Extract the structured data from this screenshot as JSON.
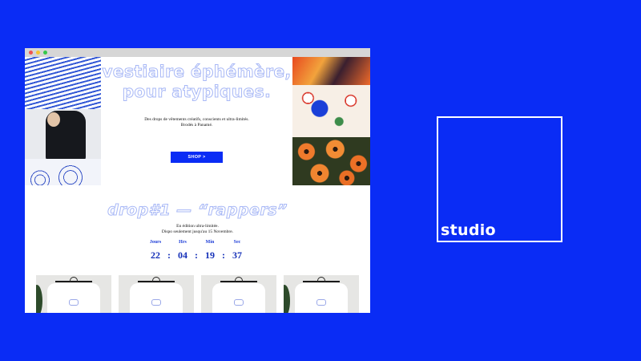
{
  "hero": {
    "headline_line1": "vestiaire éphémère,",
    "headline_line2": "pour atypiques.",
    "tagline_line1": "Des drops de vêtements créatifs, conscients et ultra-limités.",
    "tagline_line2": "Brodés à Panamé.",
    "shop_button": "SHOP >"
  },
  "drop": {
    "title": "drop#1 — “rappers”",
    "subtitle_line1": "En édition ultra-limitée.",
    "subtitle_line2": "Dispo seulement jusqu'au 15 Novembre.",
    "countdown": {
      "labels": [
        "Jours",
        "Hrs",
        "Min",
        "Sec"
      ],
      "values": [
        "22",
        "04",
        "19",
        "37"
      ],
      "separator": ":"
    }
  },
  "products": [
    {
      "item": "t-shirt"
    },
    {
      "item": "t-shirt"
    },
    {
      "item": "t-shirt"
    },
    {
      "item": "t-shirt"
    }
  ],
  "brand": {
    "logo_text": "studio"
  },
  "colors": {
    "background": "#0a2cf5",
    "accent": "#0a2cf5",
    "outline_text": "#a8b8f6"
  }
}
